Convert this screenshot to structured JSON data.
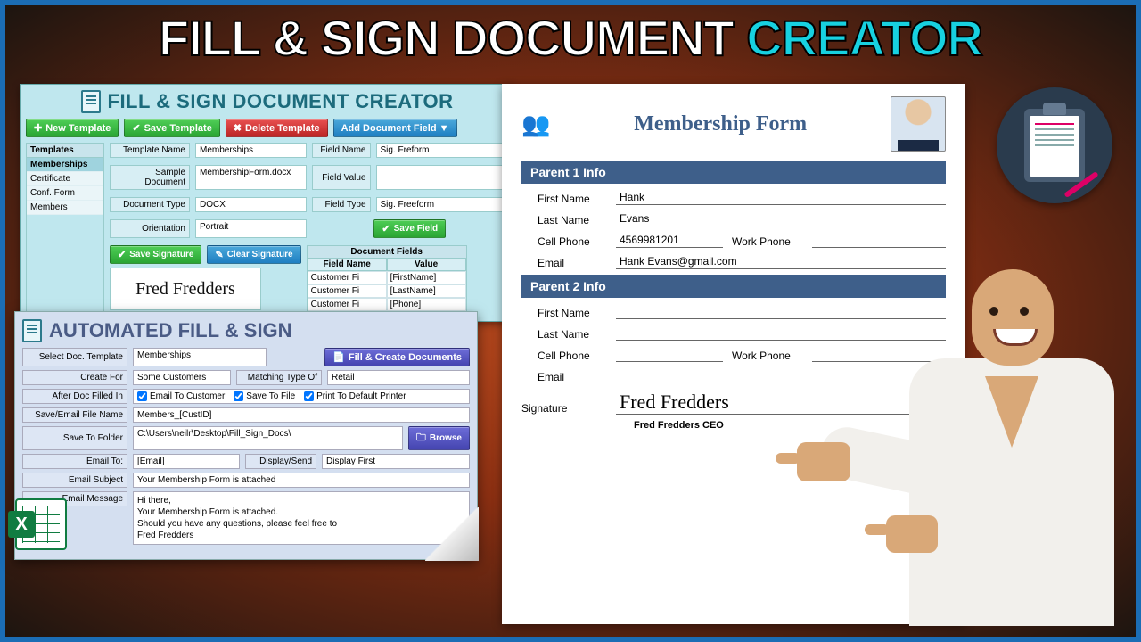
{
  "headline": {
    "main": "FILL & SIGN DOCUMENT ",
    "accent": "CREATOR"
  },
  "creator": {
    "title": "FILL & SIGN DOCUMENT CREATOR",
    "buttons": {
      "new": "New Template",
      "save": "Save Template",
      "delete": "Delete Template",
      "addField": "Add Document Field ▼",
      "saveSig": "Save Signature",
      "clearSig": "Clear Signature",
      "saveField": "Save Field"
    },
    "templates": {
      "header": "Templates",
      "items": [
        "Memberships",
        "Certificate",
        "Conf. Form",
        "Members"
      ],
      "selectedIndex": 0
    },
    "fields": {
      "tplName": {
        "label": "Template Name",
        "value": "Memberships"
      },
      "sample": {
        "label": "Sample Document",
        "value": "MembershipForm.docx"
      },
      "docType": {
        "label": "Document Type",
        "value": "DOCX"
      },
      "orient": {
        "label": "Orientation",
        "value": "Portrait"
      },
      "fieldName": {
        "label": "Field Name",
        "value": "Sig. Freform"
      },
      "fieldValue": {
        "label": "Field Value",
        "value": ""
      },
      "fieldType": {
        "label": "Field Type",
        "value": "Sig. Freeform"
      }
    },
    "docFields": {
      "title": "Document Fields",
      "headers": [
        "Field Name",
        "Value"
      ],
      "rows": [
        [
          "Customer Fi",
          "[FirstName]"
        ],
        [
          "Customer Fi",
          "[LastName]"
        ],
        [
          "Customer Fi",
          "[Phone]"
        ]
      ]
    },
    "signatureSample": "Fred Fredders"
  },
  "auto": {
    "title": "AUTOMATED FILL & SIGN",
    "fillBtn": "Fill & Create Documents",
    "browseBtn": "Browse",
    "rows": {
      "selectTpl": {
        "label": "Select Doc. Template",
        "value": "Memberships"
      },
      "createFor": {
        "label": "Create For",
        "value": "Some Customers"
      },
      "matchType": {
        "label": "Matching Type Of",
        "value": "Retail"
      },
      "after": {
        "label": "After Doc Filled In"
      },
      "chkEmail": "Email To Customer",
      "chkSave": "Save To File",
      "chkPrint": "Print To Default Printer",
      "fileName": {
        "label": "Save/Email File Name",
        "value": "Members_[CustID]"
      },
      "folder": {
        "label": "Save To Folder",
        "value": "C:\\Users\\neilr\\Desktop\\Fill_Sign_Docs\\"
      },
      "emailTo": {
        "label": "Email To:",
        "value": "[Email]"
      },
      "display": {
        "label": "Display/Send",
        "value": "Display First"
      },
      "subject": {
        "label": "Email Subject",
        "value": "Your Membership Form is attached"
      },
      "msgLabel": "Email Message",
      "msg": "Hi there,\nYour Membership Form is attached.\nShould you have any questions, please feel free to\nFred Fredders"
    }
  },
  "form": {
    "title": "Membership Form",
    "sections": {
      "p1": "Parent 1 Info",
      "p2": "Parent 2 Info"
    },
    "labels": {
      "first": "First Name",
      "last": "Last Name",
      "cell": "Cell Phone",
      "work": "Work Phone",
      "email": "Email",
      "sig": "Signature"
    },
    "p1": {
      "first": "Hank",
      "last": "Evans",
      "cell": "4569981201",
      "work": "",
      "email": "Hank Evans@gmail.com"
    },
    "p2": {
      "first": "",
      "last": "",
      "cell": "",
      "work": "",
      "email": ""
    },
    "signature": "Fred Fredders",
    "sigCaption": "Fred Fredders CEO"
  }
}
